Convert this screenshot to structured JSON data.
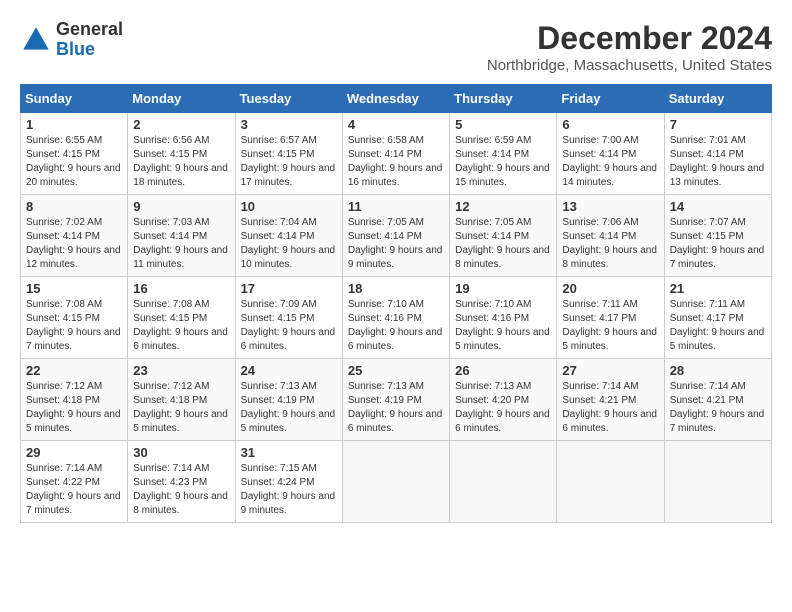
{
  "header": {
    "logo_line1": "General",
    "logo_line2": "Blue",
    "month_year": "December 2024",
    "location": "Northbridge, Massachusetts, United States"
  },
  "days_of_week": [
    "Sunday",
    "Monday",
    "Tuesday",
    "Wednesday",
    "Thursday",
    "Friday",
    "Saturday"
  ],
  "weeks": [
    [
      {
        "day": 1,
        "info": "Sunrise: 6:55 AM\nSunset: 4:15 PM\nDaylight: 9 hours and 20 minutes."
      },
      {
        "day": 2,
        "info": "Sunrise: 6:56 AM\nSunset: 4:15 PM\nDaylight: 9 hours and 18 minutes."
      },
      {
        "day": 3,
        "info": "Sunrise: 6:57 AM\nSunset: 4:15 PM\nDaylight: 9 hours and 17 minutes."
      },
      {
        "day": 4,
        "info": "Sunrise: 6:58 AM\nSunset: 4:14 PM\nDaylight: 9 hours and 16 minutes."
      },
      {
        "day": 5,
        "info": "Sunrise: 6:59 AM\nSunset: 4:14 PM\nDaylight: 9 hours and 15 minutes."
      },
      {
        "day": 6,
        "info": "Sunrise: 7:00 AM\nSunset: 4:14 PM\nDaylight: 9 hours and 14 minutes."
      },
      {
        "day": 7,
        "info": "Sunrise: 7:01 AM\nSunset: 4:14 PM\nDaylight: 9 hours and 13 minutes."
      }
    ],
    [
      {
        "day": 8,
        "info": "Sunrise: 7:02 AM\nSunset: 4:14 PM\nDaylight: 9 hours and 12 minutes."
      },
      {
        "day": 9,
        "info": "Sunrise: 7:03 AM\nSunset: 4:14 PM\nDaylight: 9 hours and 11 minutes."
      },
      {
        "day": 10,
        "info": "Sunrise: 7:04 AM\nSunset: 4:14 PM\nDaylight: 9 hours and 10 minutes."
      },
      {
        "day": 11,
        "info": "Sunrise: 7:05 AM\nSunset: 4:14 PM\nDaylight: 9 hours and 9 minutes."
      },
      {
        "day": 12,
        "info": "Sunrise: 7:05 AM\nSunset: 4:14 PM\nDaylight: 9 hours and 8 minutes."
      },
      {
        "day": 13,
        "info": "Sunrise: 7:06 AM\nSunset: 4:14 PM\nDaylight: 9 hours and 8 minutes."
      },
      {
        "day": 14,
        "info": "Sunrise: 7:07 AM\nSunset: 4:15 PM\nDaylight: 9 hours and 7 minutes."
      }
    ],
    [
      {
        "day": 15,
        "info": "Sunrise: 7:08 AM\nSunset: 4:15 PM\nDaylight: 9 hours and 7 minutes."
      },
      {
        "day": 16,
        "info": "Sunrise: 7:08 AM\nSunset: 4:15 PM\nDaylight: 9 hours and 6 minutes."
      },
      {
        "day": 17,
        "info": "Sunrise: 7:09 AM\nSunset: 4:15 PM\nDaylight: 9 hours and 6 minutes."
      },
      {
        "day": 18,
        "info": "Sunrise: 7:10 AM\nSunset: 4:16 PM\nDaylight: 9 hours and 6 minutes."
      },
      {
        "day": 19,
        "info": "Sunrise: 7:10 AM\nSunset: 4:16 PM\nDaylight: 9 hours and 5 minutes."
      },
      {
        "day": 20,
        "info": "Sunrise: 7:11 AM\nSunset: 4:17 PM\nDaylight: 9 hours and 5 minutes."
      },
      {
        "day": 21,
        "info": "Sunrise: 7:11 AM\nSunset: 4:17 PM\nDaylight: 9 hours and 5 minutes."
      }
    ],
    [
      {
        "day": 22,
        "info": "Sunrise: 7:12 AM\nSunset: 4:18 PM\nDaylight: 9 hours and 5 minutes."
      },
      {
        "day": 23,
        "info": "Sunrise: 7:12 AM\nSunset: 4:18 PM\nDaylight: 9 hours and 5 minutes."
      },
      {
        "day": 24,
        "info": "Sunrise: 7:13 AM\nSunset: 4:19 PM\nDaylight: 9 hours and 5 minutes."
      },
      {
        "day": 25,
        "info": "Sunrise: 7:13 AM\nSunset: 4:19 PM\nDaylight: 9 hours and 6 minutes."
      },
      {
        "day": 26,
        "info": "Sunrise: 7:13 AM\nSunset: 4:20 PM\nDaylight: 9 hours and 6 minutes."
      },
      {
        "day": 27,
        "info": "Sunrise: 7:14 AM\nSunset: 4:21 PM\nDaylight: 9 hours and 6 minutes."
      },
      {
        "day": 28,
        "info": "Sunrise: 7:14 AM\nSunset: 4:21 PM\nDaylight: 9 hours and 7 minutes."
      }
    ],
    [
      {
        "day": 29,
        "info": "Sunrise: 7:14 AM\nSunset: 4:22 PM\nDaylight: 9 hours and 7 minutes."
      },
      {
        "day": 30,
        "info": "Sunrise: 7:14 AM\nSunset: 4:23 PM\nDaylight: 9 hours and 8 minutes."
      },
      {
        "day": 31,
        "info": "Sunrise: 7:15 AM\nSunset: 4:24 PM\nDaylight: 9 hours and 9 minutes."
      },
      null,
      null,
      null,
      null
    ]
  ]
}
